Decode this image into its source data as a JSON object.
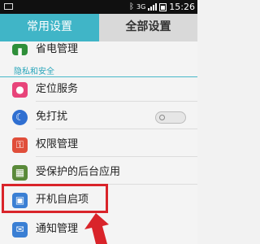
{
  "status_bar": {
    "time": "15:26",
    "indicator_text": "3G",
    "icons": [
      "image-icon",
      "nfc-icon",
      "signal-icon",
      "battery-icon"
    ]
  },
  "tabs": [
    {
      "label": "常用设置",
      "active": true
    },
    {
      "label": "全部设置",
      "active": false
    }
  ],
  "items": {
    "power_management": "省电管理",
    "section_privacy": "隐私和安全",
    "location": "定位服务",
    "do_not_disturb": "免打扰",
    "permissions": "权限管理",
    "protected_apps": "受保护的后台应用",
    "startup_apps": "开机自启项",
    "notifications": "通知管理"
  },
  "colors": {
    "accent": "#40b5c7",
    "highlight": "#d9242a"
  }
}
